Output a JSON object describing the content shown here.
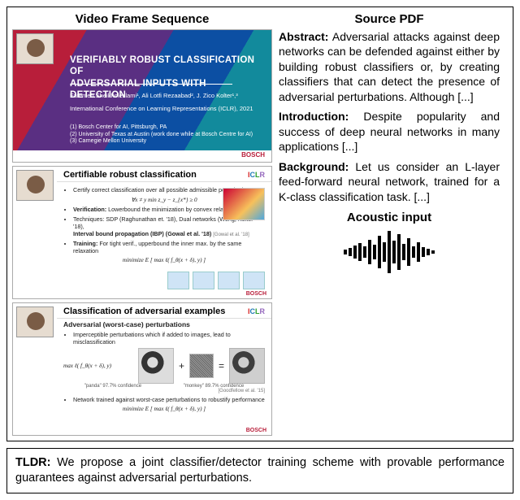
{
  "columns": {
    "video_title": "Video Frame Sequence",
    "pdf_title": "Source PDF",
    "acoustic_title": "Acoustic input"
  },
  "slide1": {
    "title_l1": "VERIFIABLY ROBUST CLASSIFICATION OF",
    "title_l2": "ADVERSARIAL INPUTS WITH DETECTION",
    "authors": "Fatemeh Sheikholeslami¹, Ali Lotfi Rezaabad², J. Zico Kolter¹,³",
    "conference": "International Conference on Learning Representations (ICLR), 2021",
    "affil1": "(1) Bosch Center for AI, Pittsburgh, PA",
    "affil2": "(2) University of Texas at Austin (work done while at Bosch Centre for AI)",
    "affil3": "(3) Carnegie Mellon University",
    "logo": "BOSCH"
  },
  "slide2": {
    "title": "Certifiable robust classification",
    "iclr": "ICLR",
    "bul1": "Certify correct classification over all possible admissible perturbations",
    "math1": "∀x ≠ y   min  z_y − z_{x*} ≥ 0",
    "bul2_a": "Verification:",
    "bul2_b": " Lowerbound the minimization by convex relaxation  ẑ_i ≤ ẑ_i",
    "bul3": "Techniques: SDP (Raghunathan et. '18), Dual networks (Wong, Kolter '18),",
    "bul3b": "Interval bound propagation (IBP) (Gowal et al. '18)",
    "bul4_a": "Training:",
    "bul4_b": " For tight verif., upperbound the inner max. by the same relaxation",
    "math2": "minimize   E    [ max   ℓ( f_θ(x + δ), y) ]",
    "ref": "[Gowal et al. '18]",
    "logo": "BOSCH"
  },
  "slide3": {
    "title": "Classification of adversarial examples",
    "subtitle": "Adversarial (worst-case) perturbations",
    "iclr": "ICLR",
    "bul1": "Imperceptible perturbations which if added to images, lead to misclassification",
    "math1": "max   ℓ( f_θ(x + δ), y)",
    "capA": "\"panda\"  97.7% confidence",
    "capB": "\"monkey\"  89.7% confidence",
    "bul2": "Network trained against worst-case perturbations to robustify performance",
    "math2": "minimize   E    [ max   ℓ( f_θ(x + δ), y) ]",
    "ref": "[Goodfellow et al. '15]",
    "logo": "BOSCH"
  },
  "pdf": {
    "abs_label": "Abstract:",
    "abs_text": " Adversarial attacks against deep networks can be defended against either by building robust classifiers or, by creating classifiers that can detect the presence of adversarial perturbations. Although [...]",
    "intro_label": "Introduction:",
    "intro_text": " Despite popularity and success of deep neural networks in many applications [...]",
    "bg_label": "Background:",
    "bg_text": " Let us consider an L-layer feed-forward neural network, trained for a K-class classification task. [...]"
  },
  "tldr": {
    "label": "TLDR:",
    "text": " We propose a joint classifier/detector training scheme with provable performance guarantees against adversarial perturbations."
  },
  "wave_heights": [
    6,
    10,
    16,
    22,
    14,
    30,
    18,
    40,
    24,
    52,
    28,
    44,
    20,
    34,
    14,
    24,
    12,
    8,
    4
  ]
}
